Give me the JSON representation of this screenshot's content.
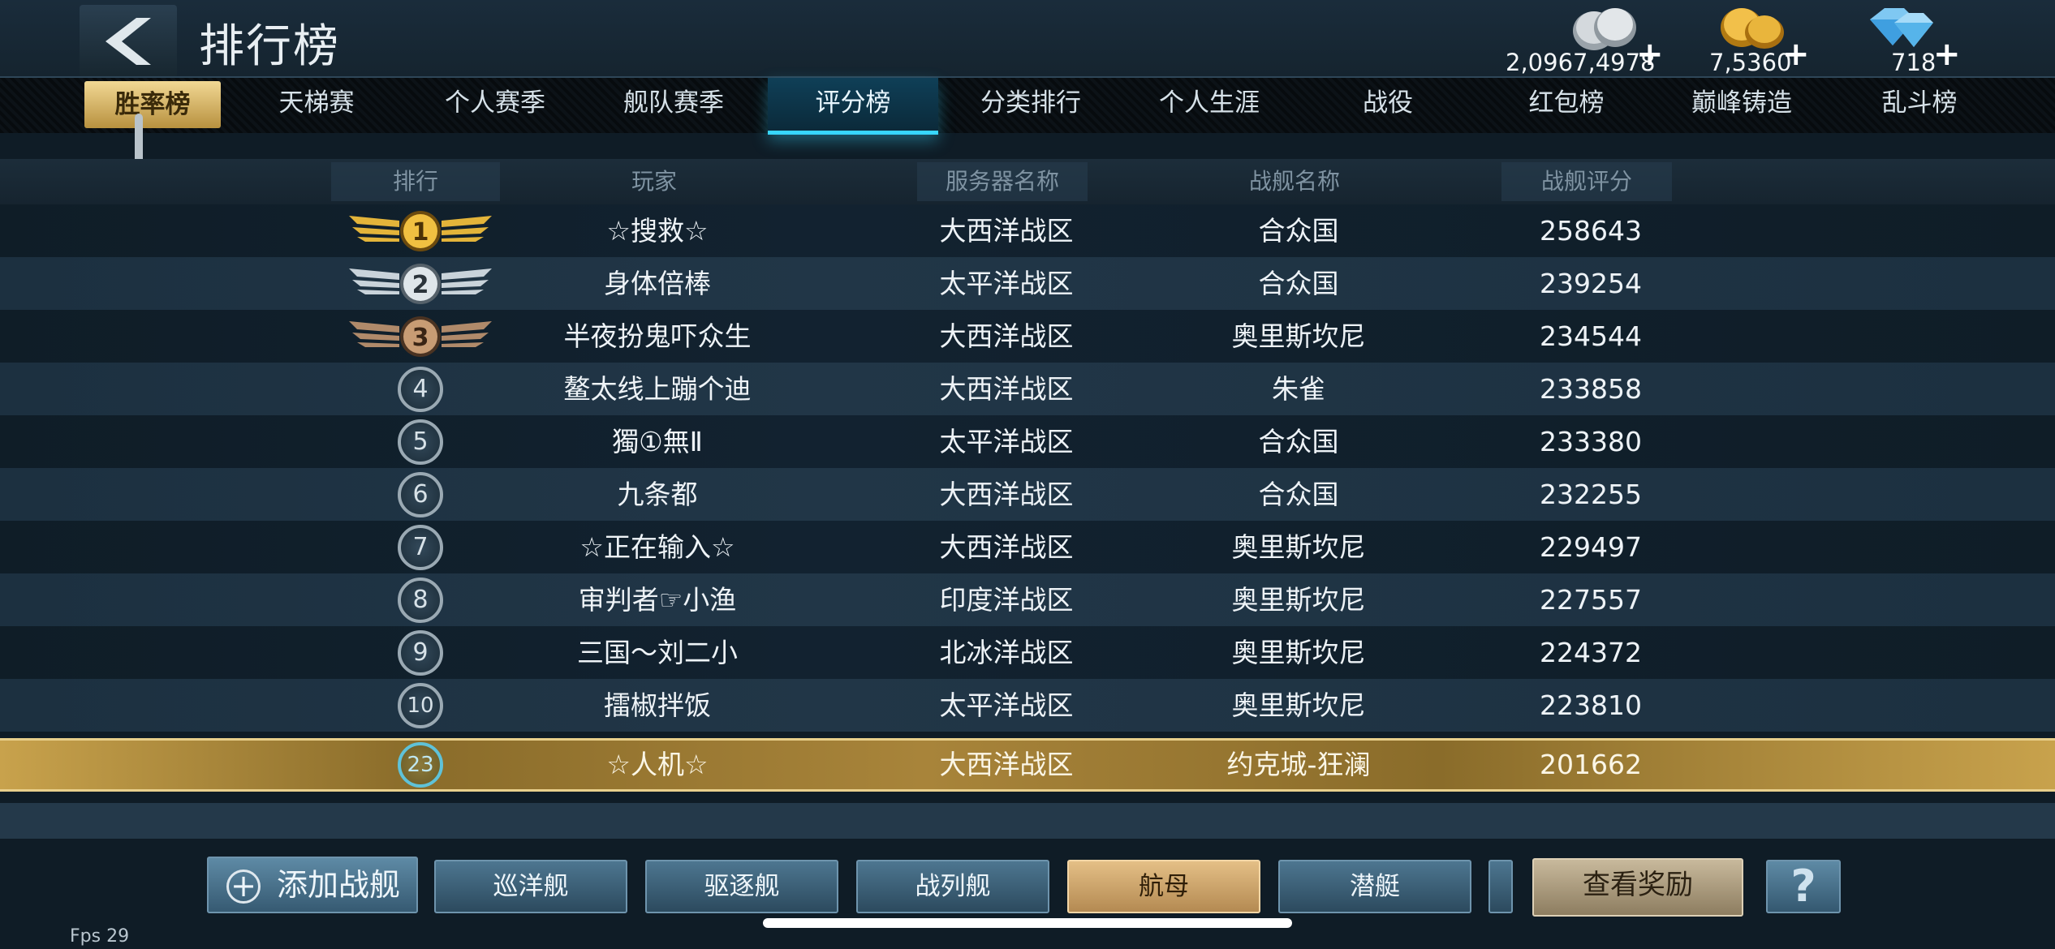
{
  "header": {
    "title": "排行榜",
    "currencies": [
      {
        "icon": "silver-coin-icon",
        "value": "2,0967,4978"
      },
      {
        "icon": "gold-coin-icon",
        "value": "7,5360"
      },
      {
        "icon": "diamond-icon",
        "value": "718"
      }
    ]
  },
  "tabs": [
    "胜率榜",
    "天梯赛",
    "个人赛季",
    "舰队赛季",
    "评分榜",
    "分类排行",
    "个人生涯",
    "战役",
    "红包榜",
    "巅峰铸造",
    "乱斗榜"
  ],
  "active_tab": "评分榜",
  "table": {
    "headers": [
      "排行",
      "玩家",
      "服务器名称",
      "战舰名称",
      "战舰评分"
    ],
    "rows": [
      {
        "rank": "1",
        "player": "☆搜救☆",
        "server": "大西洋战区",
        "ship": "合众国",
        "score": "258643"
      },
      {
        "rank": "2",
        "player": "身体倍棒",
        "server": "太平洋战区",
        "ship": "合众国",
        "score": "239254"
      },
      {
        "rank": "3",
        "player": "半夜扮鬼吓众生",
        "server": "大西洋战区",
        "ship": "奥里斯坎尼",
        "score": "234544"
      },
      {
        "rank": "4",
        "player": "鳌太线上蹦个迪",
        "server": "大西洋战区",
        "ship": "朱雀",
        "score": "233858"
      },
      {
        "rank": "5",
        "player": "獨①無Ⅱ",
        "server": "太平洋战区",
        "ship": "合众国",
        "score": "233380"
      },
      {
        "rank": "6",
        "player": "九条都",
        "server": "大西洋战区",
        "ship": "合众国",
        "score": "232255"
      },
      {
        "rank": "7",
        "player": "☆正在输入☆",
        "server": "大西洋战区",
        "ship": "奥里斯坎尼",
        "score": "229497"
      },
      {
        "rank": "8",
        "player": "审判者☞小渔",
        "server": "印度洋战区",
        "ship": "奥里斯坎尼",
        "score": "227557"
      },
      {
        "rank": "9",
        "player": "三国～刘二小",
        "server": "北冰洋战区",
        "ship": "奥里斯坎尼",
        "score": "224372"
      },
      {
        "rank": "10",
        "player": "擂椒拌饭",
        "server": "太平洋战区",
        "ship": "奥里斯坎尼",
        "score": "223810"
      }
    ],
    "my_row": {
      "rank": "23",
      "player": "☆人机☆",
      "server": "大西洋战区",
      "ship": "约克城-狂澜",
      "score": "201662"
    }
  },
  "bottom": {
    "add_ship": "添加战舰",
    "categories": [
      "巡洋舰",
      "驱逐舰",
      "战列舰",
      "航母",
      "潜艇"
    ],
    "selected_category": "航母",
    "reward": "查看奖励",
    "help": "?"
  },
  "fps": "Fps 29"
}
